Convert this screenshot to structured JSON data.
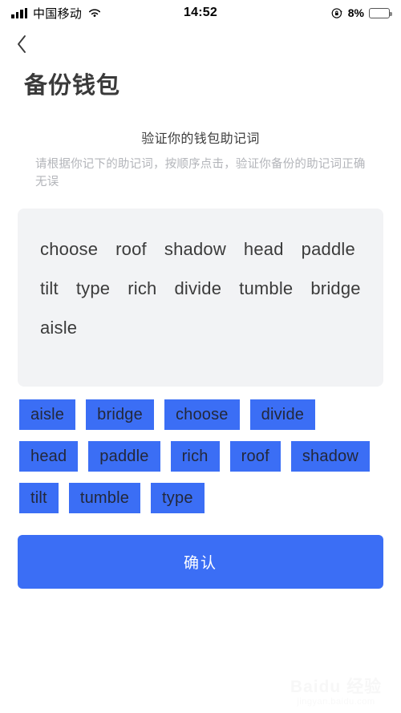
{
  "status_bar": {
    "carrier": "中国移动",
    "time": "14:52",
    "battery_percent": "8%",
    "battery_level": 8,
    "signal_icon": "signal-bars-icon",
    "wifi_icon": "wifi-icon",
    "rotation_lock_icon": "rotation-lock-icon",
    "battery_color": "#f23a2e"
  },
  "nav": {
    "back_icon": "back-chevron-icon"
  },
  "page": {
    "title": "备份钱包",
    "subtitle": "验证你的钱包助记词",
    "instruction": "请根据你记下的助记词，按顺序点击，验证你备份的助记词正确无误"
  },
  "mnemonic_panel": {
    "background_color": "#f2f3f5",
    "selected_words": [
      "choose",
      "roof",
      "shadow",
      "head",
      "paddle",
      "tilt",
      "type",
      "rich",
      "divide",
      "tumble",
      "bridge",
      "aisle"
    ]
  },
  "word_chips": {
    "accent_color": "#3b6ef5",
    "text_color": "#23283a",
    "items": [
      "aisle",
      "bridge",
      "choose",
      "divide",
      "head",
      "paddle",
      "rich",
      "roof",
      "shadow",
      "tilt",
      "tumble",
      "type"
    ]
  },
  "confirm": {
    "label": "确认",
    "color": "#3b6ef5"
  },
  "watermark": {
    "main": "Baidu 经验",
    "sub": "jingyan.baidu.com"
  }
}
